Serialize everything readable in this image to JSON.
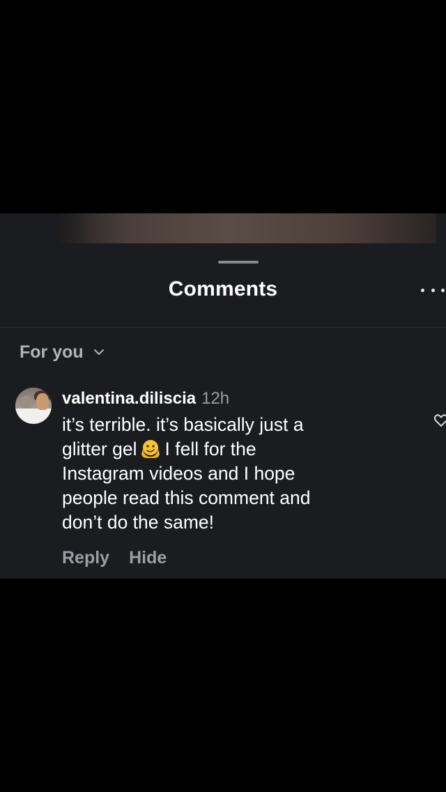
{
  "sheet": {
    "title": "Comments",
    "sort_label": "For you"
  },
  "icons": {
    "more": "more-horizontal-icon",
    "chevron": "chevron-down-icon",
    "heart": "heart-outline-icon",
    "emoji": "melting-face-emoji-icon"
  },
  "comments": [
    {
      "username": "valentina.diliscia",
      "timestamp": "12h",
      "text_lines": [
        "it’s terrible. it’s basically just a",
        "glitter gel",
        "I fell for the",
        "Instagram videos and I hope",
        "people read this comment and",
        "don’t do the same!"
      ],
      "actions": {
        "reply": "Reply",
        "hide": "Hide"
      }
    }
  ],
  "colors": {
    "panel_background": "#1b1c20",
    "page_background": "#000000",
    "primary_text": "#ffffff",
    "secondary_text": "#9d9ea3"
  }
}
